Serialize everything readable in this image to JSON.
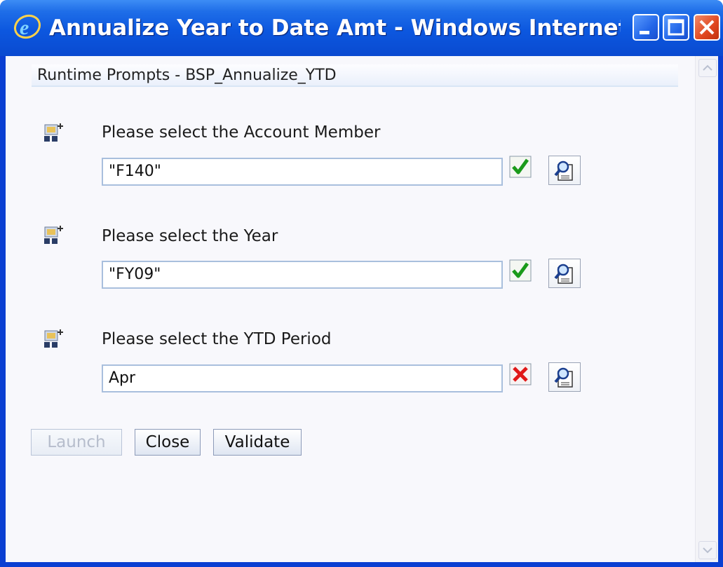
{
  "window": {
    "title": "Annualize Year to Date Amt - Windows Internet ...",
    "icon": "ie-icon"
  },
  "header": {
    "title": "Runtime Prompts - BSP_Annualize_YTD"
  },
  "prompts": [
    {
      "label": "Please select the Account Member",
      "value": "\"F140\"",
      "status": "valid"
    },
    {
      "label": "Please select the Year",
      "value": "\"FY09\"",
      "status": "valid"
    },
    {
      "label": "Please select the YTD Period",
      "value": "Apr",
      "status": "invalid"
    }
  ],
  "buttons": {
    "launch": "Launch",
    "close": "Close",
    "validate": "Validate"
  },
  "colors": {
    "titlebar": "#0a4ad0",
    "valid": "#1a9a1a",
    "invalid": "#e01818"
  }
}
